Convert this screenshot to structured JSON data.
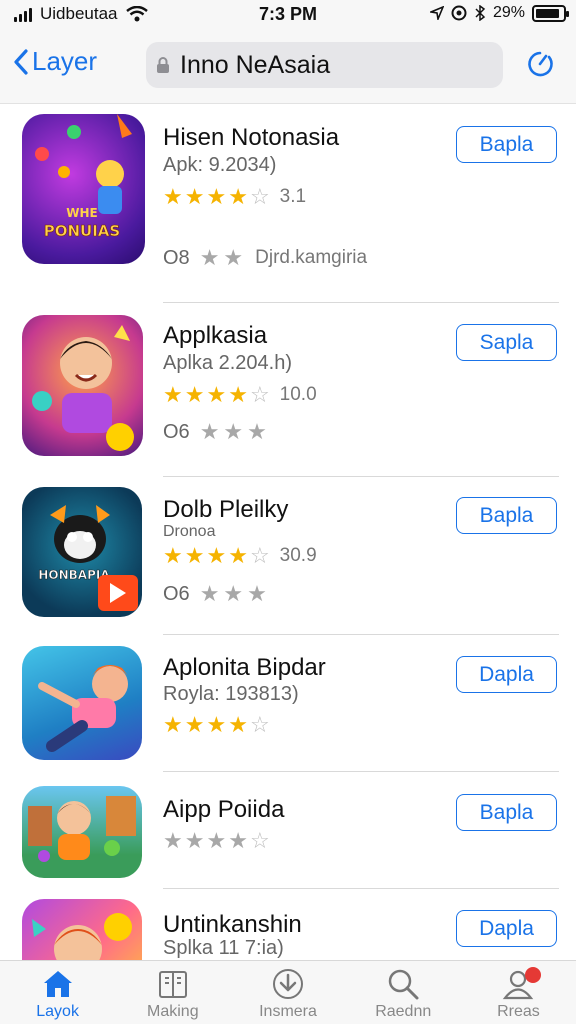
{
  "status_bar": {
    "carrier": "Uidbeutaa",
    "time": "7:3 PM",
    "battery_percent": "29%",
    "battery_level": 0.9
  },
  "nav": {
    "back_label": "Layer",
    "search_text": "Inno NeAsaia"
  },
  "apps": [
    {
      "name": "Hisen Notonasia",
      "sub": "Apk: 9.2034)",
      "rating": 4,
      "rating_text": "3.1",
      "meta_code": "O8",
      "meta_stars": 2,
      "meta_text": "Djrd.kamgiria",
      "button": "Bapla"
    },
    {
      "name": "Applkasia",
      "sub": "Aplka 2.204.h)",
      "rating": 4,
      "rating_text": "10.0",
      "meta_code": "O6",
      "meta_stars": 3,
      "meta_text": "",
      "button": "Sapla"
    },
    {
      "name": "Dolb Pleilky",
      "sub": "Dronoa",
      "rating": 4,
      "rating_text": "30.9",
      "meta_code": "O6",
      "meta_stars": 3,
      "meta_text": "",
      "button": "Bapla"
    },
    {
      "name": "Aplonita Bipdar",
      "sub": "Royla: 193813)",
      "rating": 4,
      "rating_text": "",
      "meta_code": "",
      "meta_stars": 0,
      "meta_text": "",
      "button": "Dapla"
    },
    {
      "name": "Aipp Poiida",
      "sub": "",
      "rating": 0,
      "rating_grey": 4,
      "rating_text": "",
      "meta_code": "",
      "meta_stars": 0,
      "meta_text": "",
      "button": "Bapla"
    },
    {
      "name": "Untinkanshin",
      "sub": "Splka 11 7:ia)",
      "rating": 0,
      "rating_text": "",
      "meta_code": "",
      "meta_stars": 0,
      "meta_text": "",
      "button": "Dapla"
    }
  ],
  "icon_texts": {
    "app1_title": "WHE",
    "app1_subtitle": "PONUIAS",
    "app3_title": "HONBAPIA"
  },
  "tabs": [
    {
      "label": "Layok",
      "icon": "home-icon",
      "active": true
    },
    {
      "label": "Making",
      "icon": "book-icon",
      "active": false
    },
    {
      "label": "Insmera",
      "icon": "download-icon",
      "active": false
    },
    {
      "label": "Raednn",
      "icon": "search-icon",
      "active": false
    },
    {
      "label": "Rreas",
      "icon": "person-icon",
      "active": false
    }
  ],
  "colors": {
    "accent": "#1a73e8",
    "star": "#f5b301",
    "badge": "#e53935"
  }
}
